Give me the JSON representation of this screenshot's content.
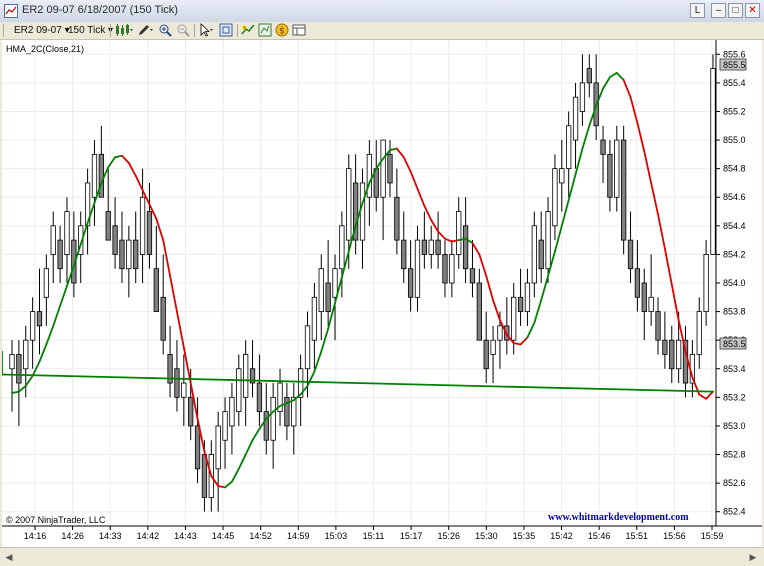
{
  "window": {
    "title": "ER2 09-07  6/18/2007  (150 Tick)",
    "btn_l": "L",
    "btn_min": "–",
    "btn_max": "□",
    "btn_close": "✕"
  },
  "toolbar": {
    "instrument": "ER2 09-07",
    "interval": "150 Tick"
  },
  "chart": {
    "indicator_label": "HMA_2C(Close,21)",
    "copyright": "© 2007 NinjaTrader, LLC",
    "watermark": "www.whitmarkdevelopment.com",
    "price_marker_top": "855.5",
    "price_marker_bottom": "853.5",
    "colors": {
      "up_body": "#ffffff",
      "down_body": "#808080",
      "hma_up": "#008000",
      "hma_down": "#e00000",
      "watermark": "#0000aa"
    }
  },
  "chart_data": {
    "type": "candlestick",
    "y_ticks": [
      "855.6",
      "855.4",
      "855.2",
      "855.0",
      "854.8",
      "854.6",
      "854.4",
      "854.2",
      "854.0",
      "853.8",
      "853.6",
      "853.4",
      "853.2",
      "853.0",
      "852.8",
      "852.6",
      "852.4"
    ],
    "x_ticks": [
      "14:16",
      "14:26",
      "14:33",
      "14:42",
      "14:43",
      "14:45",
      "14:52",
      "14:59",
      "15:03",
      "15:11",
      "15:17",
      "15:26",
      "15:30",
      "15:35",
      "15:42",
      "15:46",
      "15:51",
      "15:56",
      "15:59"
    ],
    "ylim": [
      852.3,
      855.7
    ],
    "candles": [
      [
        853.4,
        853.6,
        853.1,
        853.5
      ],
      [
        853.5,
        853.6,
        853.0,
        853.3
      ],
      [
        853.4,
        853.7,
        853.2,
        853.6
      ],
      [
        853.6,
        853.9,
        853.4,
        853.8
      ],
      [
        853.8,
        854.1,
        853.5,
        853.7
      ],
      [
        853.9,
        854.2,
        853.7,
        854.1
      ],
      [
        854.2,
        854.5,
        854.0,
        854.4
      ],
      [
        854.3,
        854.4,
        854.0,
        854.1
      ],
      [
        854.2,
        854.6,
        854.0,
        854.5
      ],
      [
        854.3,
        854.5,
        853.9,
        854.0
      ],
      [
        854.2,
        854.5,
        854.0,
        854.4
      ],
      [
        854.4,
        854.8,
        854.2,
        854.7
      ],
      [
        854.6,
        855.0,
        854.4,
        854.9
      ],
      [
        854.9,
        855.1,
        854.6,
        854.6
      ],
      [
        854.5,
        854.8,
        854.3,
        854.3
      ],
      [
        854.4,
        854.6,
        854.1,
        854.2
      ],
      [
        854.3,
        854.5,
        854.0,
        854.1
      ],
      [
        854.1,
        854.4,
        853.9,
        854.3
      ],
      [
        854.3,
        854.5,
        854.0,
        854.1
      ],
      [
        854.2,
        854.8,
        854.0,
        854.6
      ],
      [
        854.5,
        854.7,
        854.1,
        854.2
      ],
      [
        854.1,
        854.4,
        853.8,
        853.8
      ],
      [
        853.9,
        854.2,
        853.5,
        853.6
      ],
      [
        853.5,
        853.7,
        853.2,
        853.3
      ],
      [
        853.4,
        853.6,
        853.1,
        853.2
      ],
      [
        853.2,
        853.5,
        853.0,
        853.3
      ],
      [
        853.2,
        853.4,
        852.9,
        853.0
      ],
      [
        853.0,
        853.2,
        852.6,
        852.7
      ],
      [
        852.8,
        852.9,
        852.4,
        852.5
      ],
      [
        852.5,
        852.9,
        852.4,
        852.8
      ],
      [
        852.7,
        853.1,
        852.4,
        853.0
      ],
      [
        852.9,
        853.2,
        852.7,
        853.1
      ],
      [
        853.0,
        853.3,
        852.8,
        853.2
      ],
      [
        853.1,
        853.5,
        853.0,
        853.4
      ],
      [
        853.2,
        853.6,
        853.0,
        853.5
      ],
      [
        853.4,
        853.6,
        853.2,
        853.3
      ],
      [
        853.3,
        853.5,
        853.0,
        853.1
      ],
      [
        853.1,
        853.3,
        852.8,
        852.9
      ],
      [
        852.9,
        853.3,
        852.7,
        853.2
      ],
      [
        853.1,
        853.4,
        853.0,
        853.3
      ],
      [
        853.2,
        853.3,
        852.9,
        853.0
      ],
      [
        853.0,
        853.3,
        852.8,
        853.2
      ],
      [
        853.2,
        853.5,
        853.0,
        853.4
      ],
      [
        853.4,
        853.8,
        853.2,
        853.7
      ],
      [
        853.6,
        854.0,
        853.4,
        853.9
      ],
      [
        853.8,
        854.2,
        853.6,
        854.1
      ],
      [
        854.0,
        854.3,
        853.7,
        853.8
      ],
      [
        853.9,
        854.2,
        853.6,
        854.1
      ],
      [
        854.1,
        854.5,
        853.9,
        854.4
      ],
      [
        854.3,
        854.9,
        854.1,
        854.8
      ],
      [
        854.7,
        854.9,
        854.2,
        854.3
      ],
      [
        854.3,
        854.8,
        854.1,
        854.7
      ],
      [
        854.6,
        855.0,
        854.4,
        854.9
      ],
      [
        854.8,
        855.0,
        854.5,
        854.6
      ],
      [
        854.6,
        855.0,
        854.3,
        855.0
      ],
      [
        854.9,
        855.0,
        854.6,
        854.7
      ],
      [
        854.6,
        854.8,
        854.2,
        854.3
      ],
      [
        854.3,
        854.5,
        854.0,
        854.1
      ],
      [
        854.1,
        854.3,
        853.8,
        853.9
      ],
      [
        853.9,
        854.4,
        853.8,
        854.3
      ],
      [
        854.3,
        854.5,
        854.1,
        854.2
      ],
      [
        854.2,
        854.4,
        854.1,
        854.3
      ],
      [
        854.3,
        854.5,
        854.1,
        854.2
      ],
      [
        854.2,
        854.3,
        853.9,
        854.0
      ],
      [
        854.0,
        854.3,
        853.9,
        854.2
      ],
      [
        854.2,
        854.6,
        854.1,
        854.5
      ],
      [
        854.4,
        854.6,
        854.0,
        854.1
      ],
      [
        854.1,
        854.3,
        853.9,
        854.0
      ],
      [
        854.0,
        854.1,
        853.6,
        853.6
      ],
      [
        853.6,
        853.8,
        853.3,
        853.4
      ],
      [
        853.5,
        853.7,
        853.3,
        853.6
      ],
      [
        853.6,
        853.8,
        853.4,
        853.7
      ],
      [
        853.7,
        853.9,
        853.5,
        853.6
      ],
      [
        853.6,
        854.0,
        853.5,
        853.9
      ],
      [
        853.9,
        854.1,
        853.7,
        853.8
      ],
      [
        853.8,
        854.1,
        853.7,
        854.0
      ],
      [
        854.0,
        854.5,
        853.9,
        854.4
      ],
      [
        854.3,
        854.5,
        854.0,
        854.1
      ],
      [
        854.1,
        854.6,
        854.0,
        854.5
      ],
      [
        854.4,
        854.9,
        854.3,
        854.8
      ],
      [
        854.7,
        855.0,
        854.5,
        854.8
      ],
      [
        854.8,
        855.2,
        854.6,
        855.1
      ],
      [
        855.0,
        855.4,
        854.8,
        855.3
      ],
      [
        855.2,
        855.6,
        855.1,
        855.4
      ],
      [
        855.5,
        855.6,
        855.3,
        855.4
      ],
      [
        855.4,
        855.6,
        855.0,
        855.1
      ],
      [
        855.0,
        855.1,
        854.7,
        854.9
      ],
      [
        854.9,
        855.0,
        854.5,
        854.6
      ],
      [
        854.6,
        855.1,
        854.5,
        855.0
      ],
      [
        855.0,
        855.1,
        854.2,
        854.3
      ],
      [
        854.3,
        854.5,
        854.0,
        854.1
      ],
      [
        854.1,
        854.3,
        853.8,
        853.9
      ],
      [
        854.0,
        854.1,
        853.6,
        853.8
      ],
      [
        853.8,
        854.2,
        853.7,
        853.9
      ],
      [
        853.8,
        853.9,
        853.5,
        853.6
      ],
      [
        853.6,
        853.8,
        853.4,
        853.5
      ],
      [
        853.6,
        853.7,
        853.3,
        853.4
      ],
      [
        853.4,
        853.8,
        853.3,
        853.6
      ],
      [
        853.6,
        853.7,
        853.2,
        853.3
      ],
      [
        853.3,
        853.6,
        853.2,
        853.5
      ],
      [
        853.5,
        853.9,
        853.4,
        853.8
      ],
      [
        853.8,
        854.3,
        853.7,
        854.2
      ],
      [
        854.2,
        855.6,
        854.2,
        855.5
      ]
    ],
    "hma": [
      853.23,
      853.24,
      853.28,
      853.35,
      853.45,
      853.57,
      853.7,
      853.84,
      853.98,
      854.12,
      854.27,
      854.42,
      854.56,
      854.7,
      854.81,
      854.88,
      854.89,
      854.84,
      854.75,
      854.65,
      854.55,
      854.45,
      854.3,
      854.05,
      853.8,
      853.55,
      853.3,
      853.05,
      852.82,
      852.65,
      852.58,
      852.57,
      852.61,
      852.7,
      852.8,
      852.9,
      852.98,
      853.05,
      853.1,
      853.14,
      853.16,
      853.18,
      853.22,
      853.28,
      853.38,
      853.52,
      853.68,
      853.86,
      854.04,
      854.22,
      854.4,
      854.56,
      854.7,
      854.8,
      854.87,
      854.93,
      854.94,
      854.88,
      854.78,
      854.66,
      854.54,
      854.44,
      854.36,
      854.31,
      854.29,
      854.3,
      854.31,
      854.28,
      854.2,
      854.05,
      853.88,
      853.74,
      853.64,
      853.58,
      853.57,
      853.62,
      853.72,
      853.88,
      854.05,
      854.22,
      854.4,
      854.58,
      854.76,
      854.94,
      855.1,
      855.24,
      855.36,
      855.44,
      855.47,
      855.42,
      855.3,
      855.12,
      854.92,
      854.7,
      854.48,
      854.24,
      853.99,
      853.74,
      853.52,
      853.34,
      853.22,
      853.19,
      853.24,
      853.36,
      853.52
    ],
    "hma_colors": [
      "g",
      "g",
      "g",
      "g",
      "g",
      "g",
      "g",
      "g",
      "g",
      "g",
      "g",
      "g",
      "g",
      "g",
      "g",
      "g",
      "r",
      "r",
      "r",
      "r",
      "r",
      "r",
      "r",
      "r",
      "r",
      "r",
      "r",
      "r",
      "r",
      "r",
      "r",
      "g",
      "g",
      "g",
      "g",
      "g",
      "g",
      "g",
      "g",
      "g",
      "g",
      "g",
      "g",
      "g",
      "g",
      "g",
      "g",
      "g",
      "g",
      "g",
      "g",
      "g",
      "g",
      "g",
      "g",
      "g",
      "r",
      "r",
      "r",
      "r",
      "r",
      "r",
      "r",
      "r",
      "r",
      "g",
      "g",
      "r",
      "r",
      "r",
      "r",
      "r",
      "r",
      "r",
      "r",
      "g",
      "g",
      "g",
      "g",
      "g",
      "g",
      "g",
      "g",
      "g",
      "g",
      "g",
      "g",
      "g",
      "g",
      "r",
      "r",
      "r",
      "r",
      "r",
      "r",
      "r",
      "r",
      "r",
      "r",
      "r",
      "r",
      "r",
      "g",
      "g",
      "g",
      "g"
    ]
  }
}
